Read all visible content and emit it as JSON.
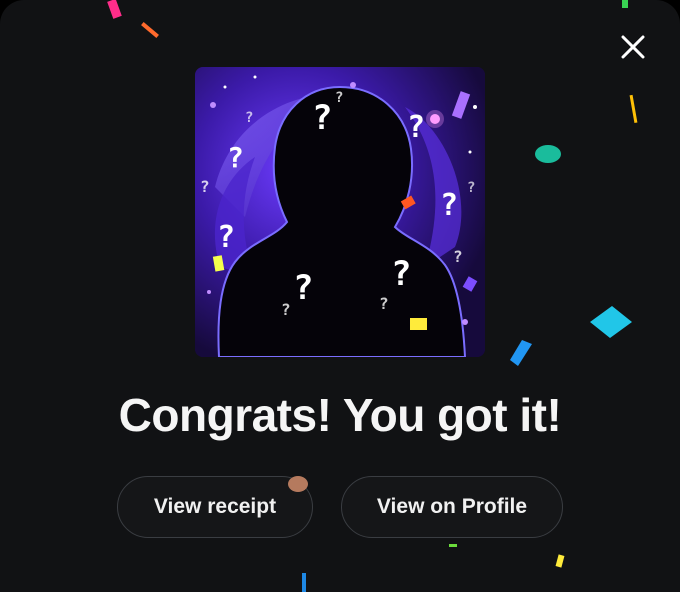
{
  "dialog": {
    "title": "Congrats! You got it!",
    "close_icon": "close-icon",
    "artwork_icon": "mystery-silhouette-artwork"
  },
  "actions": {
    "view_receipt_label": "View receipt",
    "view_profile_label": "View on Profile"
  },
  "colors": {
    "background": "#111214",
    "text": "#f5f5f5",
    "button_border": "#3a3d42",
    "art_accent": "#7b3ff2"
  }
}
